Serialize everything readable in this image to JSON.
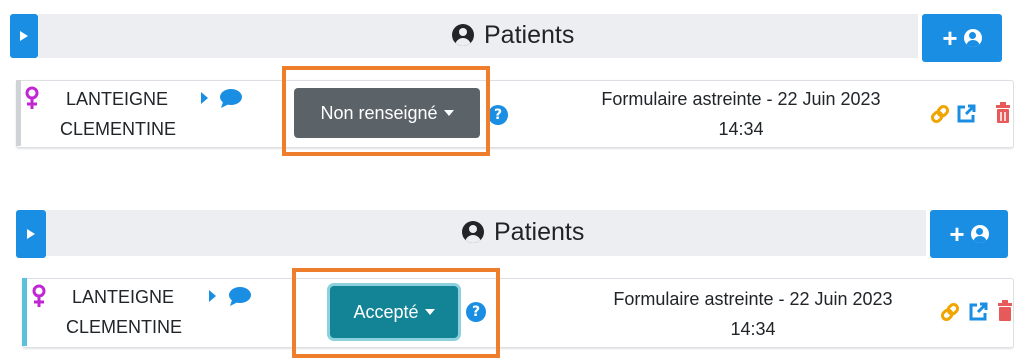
{
  "panels": [
    {
      "header": {
        "title": "Patients",
        "add_label": "+"
      },
      "patient": {
        "name_line1": "LANTEIGNE",
        "name_line2": "CLEMENTINE",
        "status_label": "Non renseigné",
        "status_color": "#5b6268",
        "form_line1": "Formulaire astreinte - 22 Juin 2023",
        "form_line2": "14:34"
      }
    },
    {
      "header": {
        "title": "Patients",
        "add_label": "+"
      },
      "patient": {
        "name_line1": "LANTEIGNE",
        "name_line2": "CLEMENTINE",
        "status_label": "Accepté",
        "status_color": "#138496",
        "form_line1": "Formulaire astreinte - 22 Juin 2023",
        "form_line2": "14:34"
      }
    }
  ],
  "colors": {
    "accent_blue": "#1a8ee3",
    "highlight_orange": "#ee7d2c",
    "female_icon": "#c026d3",
    "link_icon": "#f0a500",
    "external_icon": "#1a8ee3",
    "trash_icon": "#e85a5a"
  },
  "icons": [
    "chevron-right-icon",
    "user-circle-icon",
    "plus-icon",
    "female-icon",
    "caret-right-icon",
    "comment-icon",
    "question-circle-icon",
    "link-icon",
    "external-link-icon",
    "trash-icon"
  ]
}
